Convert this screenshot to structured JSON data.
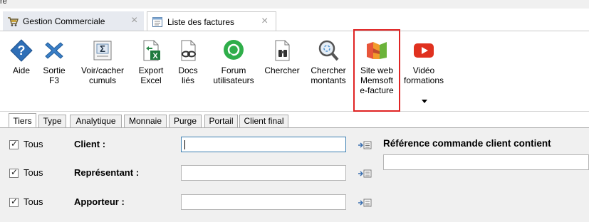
{
  "window": {
    "title_fragment": "re"
  },
  "doc_tabs": [
    {
      "label": "Gestion Commerciale",
      "close": "×"
    },
    {
      "label": "Liste des factures",
      "close": "×"
    }
  ],
  "ribbon": {
    "buttons": [
      {
        "label": "Aide",
        "icon": "help-diamond-icon"
      },
      {
        "label": "Sortie\nF3",
        "icon": "exit-x-icon"
      },
      {
        "label": "Voir/cacher\ncumuls",
        "icon": "sum-sigma-icon"
      },
      {
        "label": "Export\nExcel",
        "icon": "excel-export-icon"
      },
      {
        "label": "Docs\nliés",
        "icon": "linked-docs-icon"
      },
      {
        "label": "Forum\nutilisateurs",
        "icon": "forum-chat-icon"
      },
      {
        "label": "Chercher",
        "icon": "binoculars-icon"
      },
      {
        "label": "Chercher\nmontants",
        "icon": "magnifier-icon"
      },
      {
        "label": "Site web\nMemsoft\ne-facture",
        "icon": "memsoft-logo-icon"
      },
      {
        "label": "Vidéo\nformations",
        "icon": "youtube-play-icon"
      }
    ],
    "highlight_color": "#e02424"
  },
  "filter_tabs": [
    "Tiers",
    "Type",
    "Analytique",
    "Monnaie",
    "Purge",
    "Portail",
    "Client final"
  ],
  "filters": {
    "rows": [
      {
        "checkbox_label": "Tous",
        "checked": true,
        "label": "Client :",
        "value": ""
      },
      {
        "checkbox_label": "Tous",
        "checked": true,
        "label": "Représentant :",
        "value": ""
      },
      {
        "checkbox_label": "Tous",
        "checked": true,
        "label": "Apporteur :",
        "value": ""
      }
    ],
    "reference_label": "Référence commande client contient",
    "reference_value": ""
  }
}
